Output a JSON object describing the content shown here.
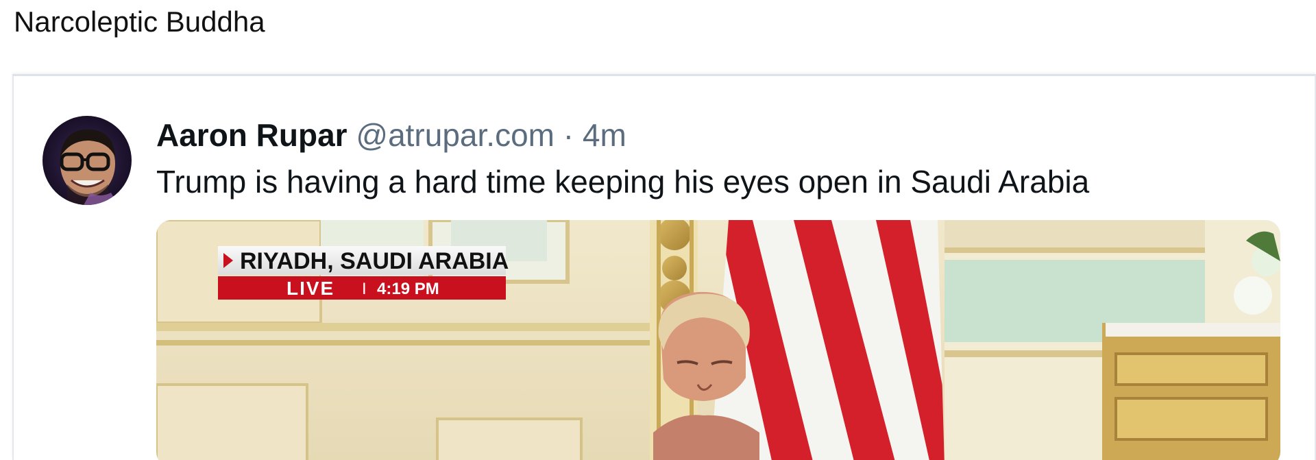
{
  "page": {
    "heading": "Narcoleptic Buddha"
  },
  "post": {
    "author_name": "Aaron Rupar",
    "author_handle": "@atrupar.com",
    "separator": "·",
    "timestamp": "4m",
    "text": "Trump is having a hard time keeping his eyes open in Saudi Arabia",
    "media": {
      "type": "video",
      "chyron": {
        "location": "RIYADH, SAUDI ARABIA",
        "live_label": "LIVE",
        "divider": "I",
        "time": "4:19 PM"
      }
    }
  },
  "colors": {
    "handle": "#5a6c7e",
    "text": "#0f1419",
    "chyron_red": "#c8101e",
    "flag_red": "#d4202a"
  }
}
